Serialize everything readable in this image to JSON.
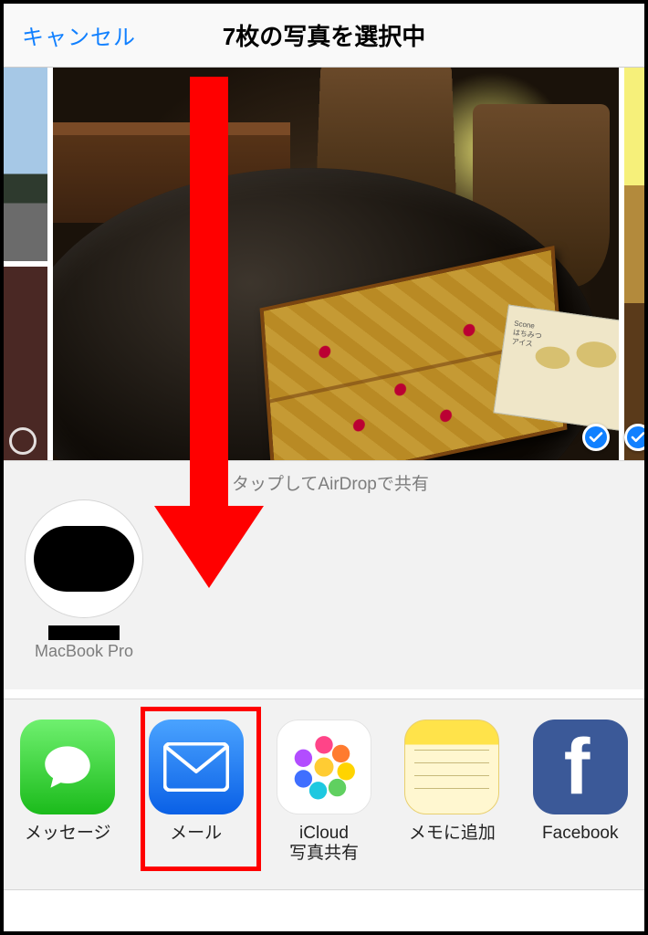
{
  "header": {
    "cancel_label": "キャンセル",
    "title": "7枚の写真を選択中"
  },
  "airdrop": {
    "hint": "タップしてAirDropで共有",
    "contact_label": "MacBook Pro"
  },
  "apps": [
    {
      "id": "messages",
      "label": "メッセージ"
    },
    {
      "id": "mail",
      "label": "メール"
    },
    {
      "id": "icloud-share",
      "label": "iCloud\n写真共有"
    },
    {
      "id": "notes",
      "label": "メモに追加"
    },
    {
      "id": "facebook",
      "label": "Facebook"
    }
  ],
  "annotation": {
    "points_to_app": "mail"
  }
}
